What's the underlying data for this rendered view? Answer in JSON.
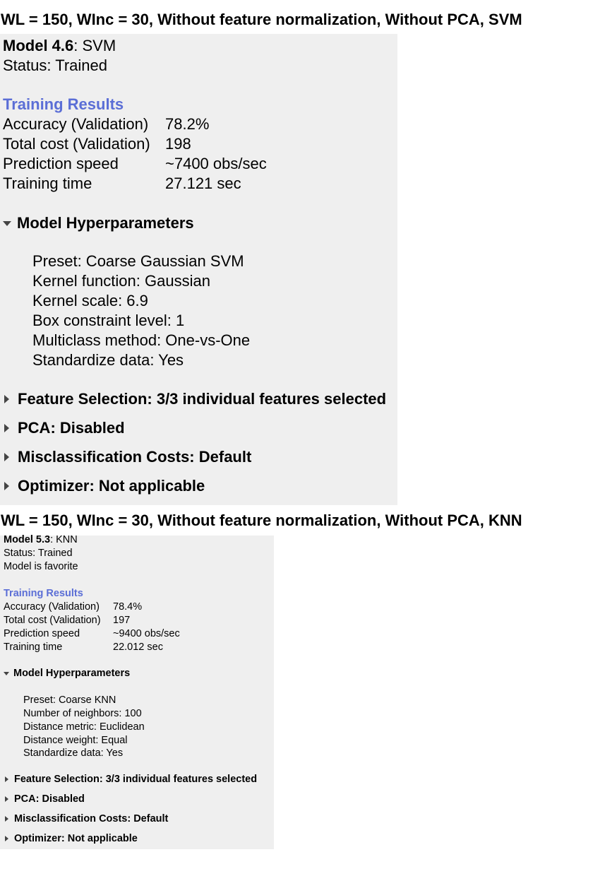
{
  "blocks": [
    {
      "section_title": "WL = 150, WInc = 30, Without feature normalization, Without PCA, SVM",
      "model_id": "Model 4.6",
      "model_type": ": SVM",
      "status": "Status: Trained",
      "favorite": "",
      "training_results_heading": "Training Results",
      "metrics": [
        {
          "label": "Accuracy (Validation)",
          "value": "78.2%"
        },
        {
          "label": "Total cost (Validation)",
          "value": "198"
        },
        {
          "label": "Prediction speed",
          "value": "~7400 obs/sec"
        },
        {
          "label": "Training time",
          "value": "27.121 sec"
        }
      ],
      "hyperparameters_heading": "Model Hyperparameters",
      "hyperparameters": [
        "Preset: Coarse Gaussian SVM",
        "Kernel function: Gaussian",
        "Kernel scale: 6.9",
        "Box constraint level: 1",
        "Multiclass method: One-vs-One",
        "Standardize data: Yes"
      ],
      "collapsed_sections": [
        "Feature Selection: 3/3 individual features selected",
        "PCA: Disabled",
        "Misclassification Costs: Default",
        "Optimizer: Not applicable"
      ]
    },
    {
      "section_title": "WL = 150, WInc = 30, Without feature normalization, Without PCA, KNN",
      "model_id": "Model 5.3",
      "model_type": ": KNN",
      "status": "Status: Trained",
      "favorite": "Model is favorite",
      "training_results_heading": "Training Results",
      "metrics": [
        {
          "label": "Accuracy (Validation)",
          "value": "78.4%"
        },
        {
          "label": "Total cost (Validation)",
          "value": "197"
        },
        {
          "label": "Prediction speed",
          "value": "~9400 obs/sec"
        },
        {
          "label": "Training time",
          "value": "22.012 sec"
        }
      ],
      "hyperparameters_heading": "Model Hyperparameters",
      "hyperparameters": [
        "Preset: Coarse KNN",
        "Number of neighbors: 100",
        "Distance metric: Euclidean",
        "Distance weight: Equal",
        "Standardize data: Yes"
      ],
      "collapsed_sections": [
        "Feature Selection: 3/3 individual features selected",
        "PCA: Disabled",
        "Misclassification Costs: Default",
        "Optimizer: Not applicable"
      ]
    }
  ],
  "colors": {
    "accent": "#5b6ed6",
    "panel_bg": "#efefef"
  },
  "icons": {
    "expanded": "triangle-down-icon",
    "collapsed": "triangle-right-icon"
  }
}
